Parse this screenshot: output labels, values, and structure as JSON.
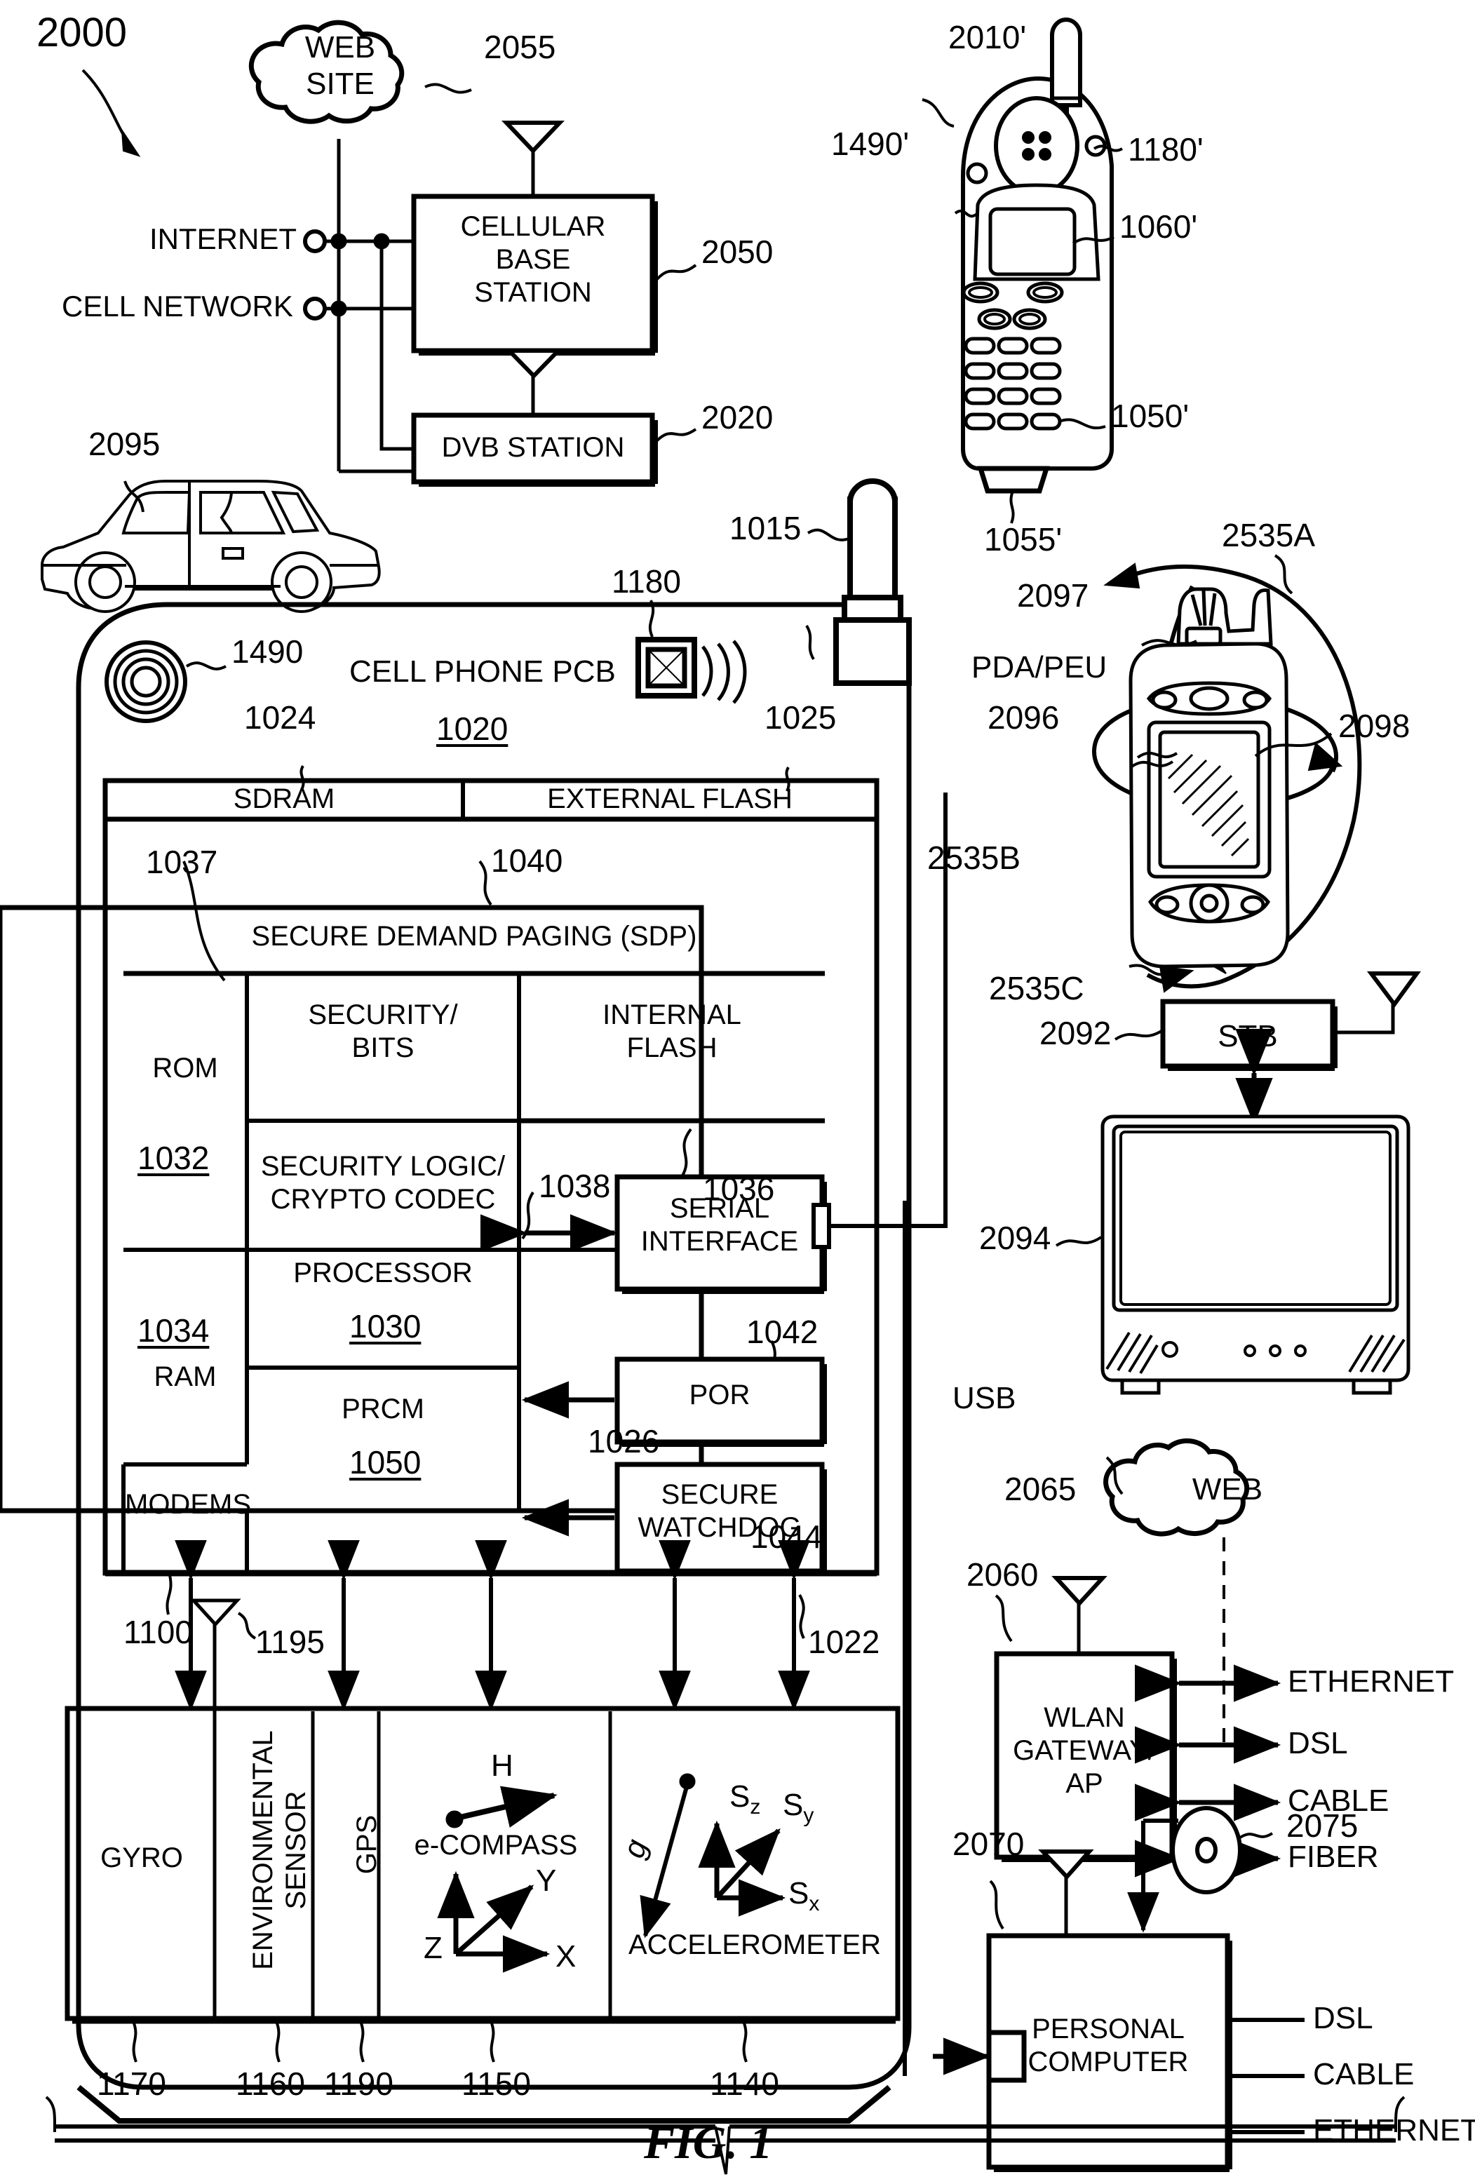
{
  "figure": {
    "caption": "FIG. 1",
    "system_number": "2000"
  },
  "network_top": {
    "website_cloud": "WEB\nSITE",
    "website_ref": "2055",
    "internet_label": "INTERNET",
    "cell_network_label": "CELL NETWORK",
    "cellular_base_station": "CELLULAR\nBASE\nSTATION",
    "cellular_base_station_ref": "2050",
    "dvb_station": "DVB STATION",
    "dvb_station_ref": "2020",
    "car_ref": "2095"
  },
  "handset_right": {
    "device_ref": "2010'",
    "speaker_ref": "1490'",
    "camera_ref": "1180'",
    "display_ref": "1060'",
    "keypad_ref": "1050'",
    "mic_ref": "1055'"
  },
  "pda": {
    "title": "PDA/PEU",
    "body_ref": "2096",
    "stylus_ref": "2097",
    "screen_ref": "2098",
    "axis_a_ref": "2535A",
    "axis_b_ref": "2535B",
    "axis_c_ref": "2535C"
  },
  "stb": {
    "label": "STB",
    "ref": "2092",
    "tv_ref": "2094"
  },
  "wlan": {
    "label": "WLAN\nGATEWAY/\nAP",
    "ref": "2060",
    "web_cloud": "WEB",
    "web_ref": "2065",
    "links": [
      "ETHERNET",
      "DSL",
      "CABLE",
      "FIBER"
    ]
  },
  "pc": {
    "label": "PERSONAL\nCOMPUTER",
    "ref": "2070",
    "disc_ref": "2075",
    "links": [
      "DSL",
      "CABLE",
      "ETHERNET"
    ]
  },
  "phone_pcb": {
    "title": "CELL PHONE PCB",
    "title_ref": "1020",
    "antenna_ref": "1015",
    "speaker_ref": "1490",
    "camera_ref": "1180",
    "rf_ref": "1025",
    "usb_label": "USB",
    "sdram": "SDRAM",
    "sdram_ref": "1024",
    "external_flash": "EXTERNAL FLASH",
    "sdp": "SECURE DEMAND PAGING (SDP)",
    "sdp_ref": "1040",
    "rom": "ROM",
    "rom_ref": "1032",
    "ram": "RAM",
    "ram_ref": "1034",
    "security_bits": "SECURITY/\nBITS",
    "security_bits_ref": "1037",
    "internal_flash": "INTERNAL\nFLASH",
    "internal_flash_ref": "1036",
    "security_logic": "SECURITY LOGIC/\nCRYPTO CODEC",
    "security_logic_ref": "1038",
    "processor": "PROCESSOR",
    "processor_ref": "1030",
    "prcm": "PRCM",
    "prcm_ref": "1050",
    "modems": "MODEMS",
    "modems_ref": "1100",
    "serial_interface": "SERIAL\nINTERFACE",
    "serial_interface_ref": "1026",
    "por": "POR",
    "por_ref": "1042",
    "secure_watchdog": "SECURE\nWATCHDOG",
    "secure_watchdog_ref": "1044",
    "bus_ref": "1022",
    "antenna_small_ref": "1195"
  },
  "sensors": {
    "cells": [
      {
        "label": "GYRO",
        "ref": "1170",
        "orientation": "horizontal"
      },
      {
        "label": "ENVIRONMENTAL\nSENSOR",
        "ref": "1160",
        "orientation": "vertical"
      },
      {
        "label": "GPS",
        "ref": "1190",
        "orientation": "vertical"
      },
      {
        "label": "e-COMPASS",
        "ref": "1150",
        "orientation": "horizontal"
      },
      {
        "label": "ACCELEROMETER",
        "ref": "1140",
        "orientation": "horizontal"
      }
    ],
    "compass_vector": "H",
    "compass_axes": [
      "Z",
      "Y",
      "X"
    ],
    "accel_gravity": "g",
    "accel_axes": [
      "S",
      "S",
      "S"
    ],
    "accel_axes_sub": [
      "z",
      "y",
      "x"
    ]
  }
}
